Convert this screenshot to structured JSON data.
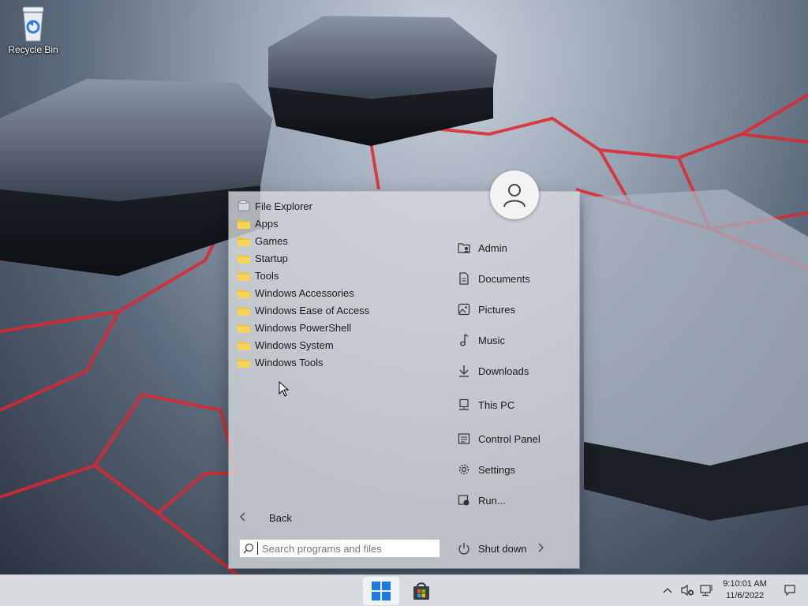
{
  "desktop": {
    "icons": [
      {
        "label": "Recycle Bin",
        "icon": "recycle-bin-icon"
      }
    ]
  },
  "start_menu": {
    "programs": [
      {
        "label": "File Explorer",
        "icon": "file-explorer-icon"
      },
      {
        "label": "Apps",
        "icon": "folder-icon"
      },
      {
        "label": "Games",
        "icon": "folder-icon"
      },
      {
        "label": "Startup",
        "icon": "folder-icon"
      },
      {
        "label": "Tools",
        "icon": "folder-icon"
      },
      {
        "label": "Windows Accessories",
        "icon": "folder-icon"
      },
      {
        "label": "Windows Ease of Access",
        "icon": "folder-icon"
      },
      {
        "label": "Windows PowerShell",
        "icon": "folder-icon"
      },
      {
        "label": "Windows System",
        "icon": "folder-icon"
      },
      {
        "label": "Windows Tools",
        "icon": "folder-icon"
      }
    ],
    "back_label": "Back",
    "search": {
      "placeholder": "Search programs and files",
      "value": ""
    },
    "places": [
      {
        "label": "Admin",
        "icon": "user-folder-icon"
      },
      {
        "label": "Documents",
        "icon": "document-icon"
      },
      {
        "label": "Pictures",
        "icon": "picture-icon"
      },
      {
        "label": "Music",
        "icon": "music-icon"
      },
      {
        "label": "Downloads",
        "icon": "download-icon"
      },
      {
        "label": "This PC",
        "icon": "computer-icon"
      },
      {
        "label": "Control Panel",
        "icon": "control-panel-icon"
      },
      {
        "label": "Settings",
        "icon": "gear-icon"
      },
      {
        "label": "Run...",
        "icon": "run-icon"
      }
    ],
    "shutdown_label": "Shut down"
  },
  "taskbar": {
    "clock": {
      "time": "9:10:01 AM",
      "date": "11/6/2022"
    }
  },
  "colors": {
    "folder": "#f2c230",
    "start_blue": "#1f7ae0",
    "wall_red": "#e0262e"
  }
}
